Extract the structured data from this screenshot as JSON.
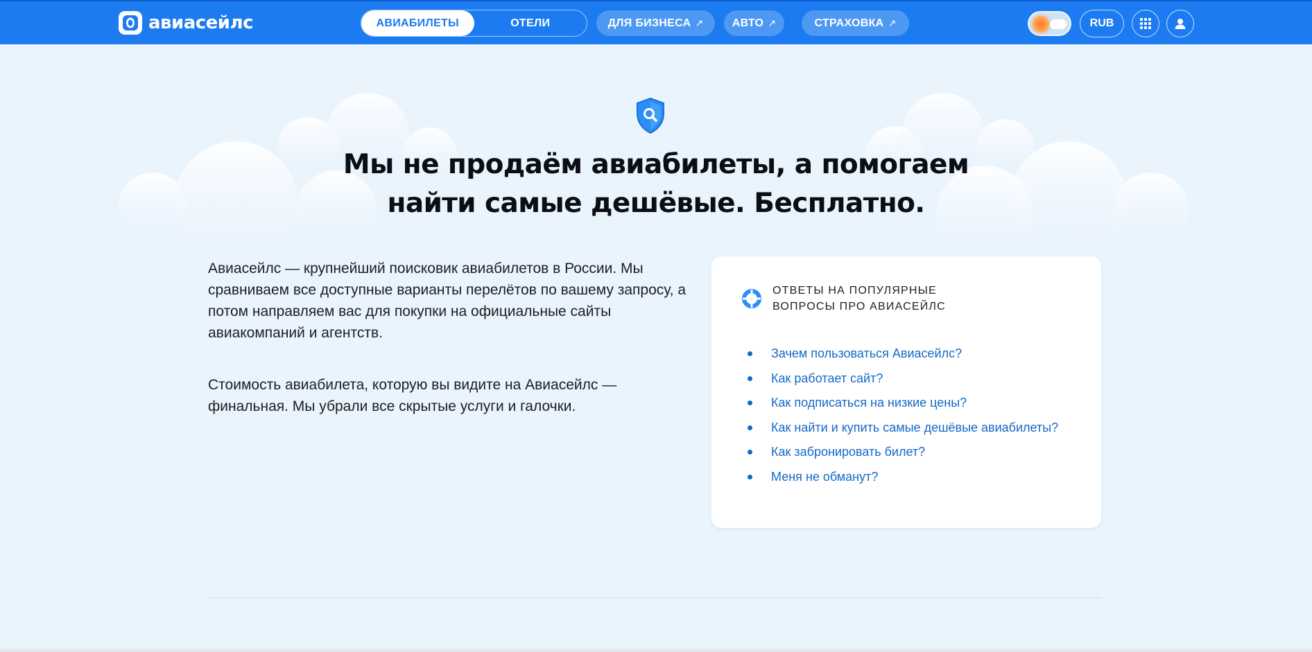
{
  "header": {
    "logo_text": "авиасейлс",
    "tabs": [
      {
        "label": "АВИАБИЛЕТЫ",
        "active": true
      },
      {
        "label": "ОТЕЛИ",
        "active": false
      }
    ],
    "links": [
      {
        "label": "ДЛЯ БИЗНЕСА",
        "icon": "arrow-up-right-icon"
      },
      {
        "label": "АВТО",
        "icon": "arrow-up-right-icon"
      },
      {
        "label": "СТРАХОВКА",
        "icon": "arrow-up-right-icon"
      }
    ],
    "currency": "RUB",
    "theme_toggle_icon": "sun-cloud-icon",
    "apps_icon": "grid-icon",
    "profile_icon": "user-icon"
  },
  "hero": {
    "icon": "shield-search-icon",
    "headline_line1": "Мы не продаём авиабилеты, а помогаем",
    "headline_line2": "найти самые дешёвые. Бесплатно."
  },
  "intro": {
    "paragraph1": "Авиасейлс — крупнейший поисковик авиабилетов в России. Мы сравниваем все доступные варианты перелётов по вашему запросу, а потом направляем вас для покупки на официальные сайты авиакомпаний и агентств.",
    "paragraph2": "Стоимость авиабилета, которую вы видите на Авиасейлс — финальная. Мы убрали все скрытые услуги и галочки."
  },
  "faq": {
    "icon": "lifebuoy-icon",
    "title_line1": "ОТВЕТЫ НА ПОПУЛЯРНЫЕ",
    "title_line2": "ВОПРОСЫ ПРО АВИАСЕЙЛС",
    "items": [
      "Зачем пользоваться Авиасейлс?",
      "Как работает сайт?",
      "Как подписаться на низкие цены?",
      "Как найти и купить самые дешёвые авиабилеты?",
      "Как забронировать билет?",
      "Меня не обманут?"
    ]
  },
  "colors": {
    "brand_blue": "#1c7bf0",
    "link_blue": "#1469c7",
    "page_bg": "#eaf4fd"
  }
}
